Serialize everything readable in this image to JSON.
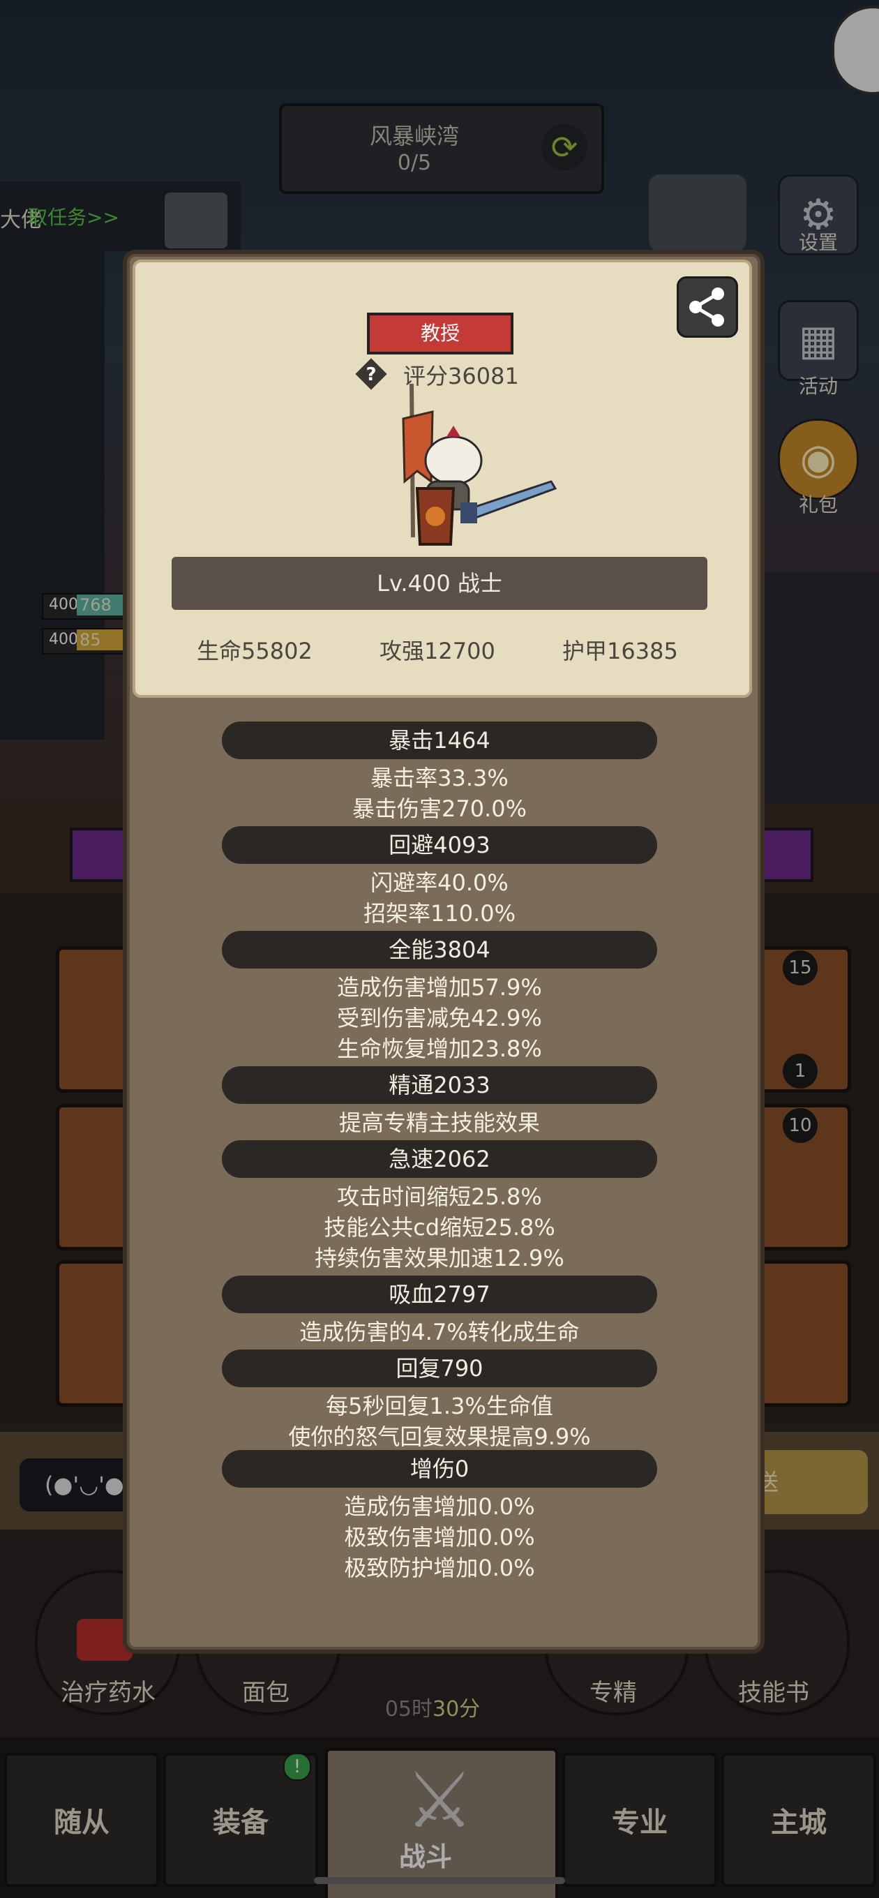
{
  "top": {
    "mission_title": "风暴峡湾",
    "mission_count": "0/5",
    "task_name_partial": "大佬",
    "task_link": "取任务>>"
  },
  "side_buttons": [
    {
      "label": "设置",
      "icon": "gear-icon"
    },
    {
      "label": "活动",
      "icon": "calendar-icon"
    },
    {
      "label": "礼包",
      "icon": "gift-icon"
    }
  ],
  "left_units": [
    {
      "level": "400",
      "hp": "768"
    },
    {
      "level": "400",
      "hp": "85"
    }
  ],
  "slot_counts": [
    "15",
    "1",
    "10"
  ],
  "chat": {
    "text": "(●'◡'●",
    "send": "送"
  },
  "quick_items": [
    {
      "label": "治疗药水",
      "icon": "potion-icon"
    },
    {
      "label": "面包",
      "icon": "bread-icon"
    },
    {
      "label": "专精",
      "icon": "mastery-icon"
    },
    {
      "label": "技能书",
      "icon": "skillbook-icon"
    }
  ],
  "timer": {
    "prefix": "05时",
    "highlight": "30分"
  },
  "tabs": {
    "companions": "随从",
    "equipment": "装备",
    "battle": "战斗",
    "profession": "专业",
    "main_city": "主城",
    "equipment_badge": "!"
  },
  "popup": {
    "rank": "教授",
    "score": "评分36081",
    "level_class": "Lv.400 战士",
    "hp": "生命55802",
    "attack": "攻强12700",
    "armor": "护甲16385",
    "sections": [
      {
        "header": "暴击1464",
        "lines": [
          "暴击率33.3%",
          "暴击伤害270.0%"
        ]
      },
      {
        "header": "回避4093",
        "lines": [
          "闪避率40.0%",
          "招架率110.0%"
        ]
      },
      {
        "header": "全能3804",
        "lines": [
          "造成伤害增加57.9%",
          "受到伤害减免42.9%",
          "生命恢复增加23.8%"
        ]
      },
      {
        "header": "精通2033",
        "lines": [
          "提高专精主技能效果"
        ]
      },
      {
        "header": "急速2062",
        "lines": [
          "攻击时间缩短25.8%",
          "技能公共cd缩短25.8%",
          "持续伤害效果加速12.9%"
        ]
      },
      {
        "header": "吸血2797",
        "lines": [
          "造成伤害的4.7%转化成生命"
        ]
      },
      {
        "header": "回复790",
        "lines": [
          "每5秒回复1.3%生命值",
          "使你的怒气回复效果提高9.9%"
        ]
      },
      {
        "header": "增伤0",
        "lines": [
          "造成伤害增加0.0%",
          "极致伤害增加0.0%",
          "极致防护增加0.0%"
        ]
      }
    ]
  }
}
